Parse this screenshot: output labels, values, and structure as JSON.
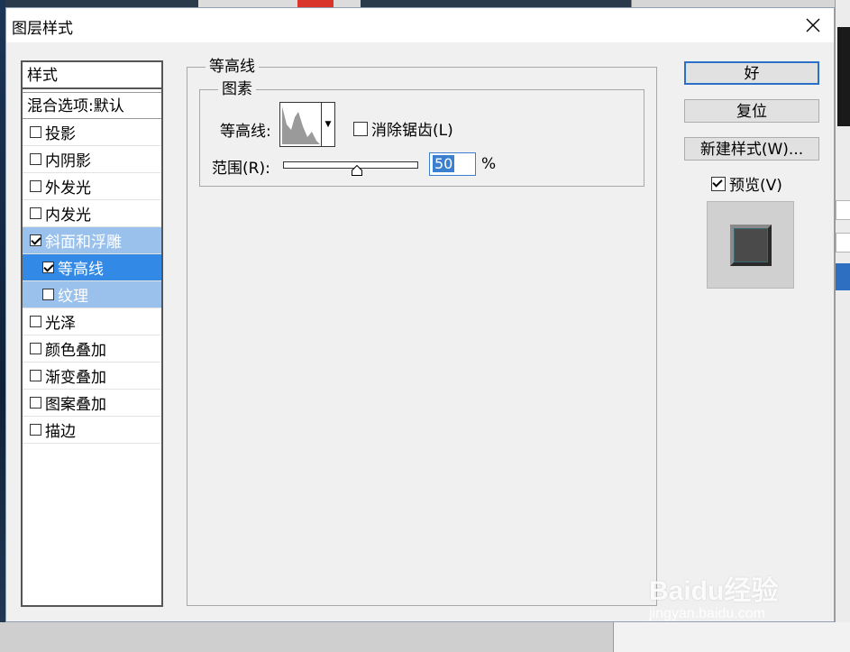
{
  "dialog": {
    "title": "图层样式"
  },
  "style_list": {
    "header": "样式",
    "blend_options": "混合选项:默认",
    "items": [
      {
        "label": "投影",
        "checked": false
      },
      {
        "label": "内阴影",
        "checked": false
      },
      {
        "label": "外发光",
        "checked": false
      },
      {
        "label": "内发光",
        "checked": false
      },
      {
        "label": "斜面和浮雕",
        "checked": true
      },
      {
        "label": "等高线",
        "checked": true
      },
      {
        "label": "纹理",
        "checked": false
      },
      {
        "label": "光泽",
        "checked": false
      },
      {
        "label": "颜色叠加",
        "checked": false
      },
      {
        "label": "渐变叠加",
        "checked": false
      },
      {
        "label": "图案叠加",
        "checked": false
      },
      {
        "label": "描边",
        "checked": false
      }
    ]
  },
  "contour_panel": {
    "group_title": "等高线",
    "subgroup_title": "图素",
    "contour_label": "等高线:",
    "antialias_label": "消除锯齿(L)",
    "antialias_checked": false,
    "range_label": "范围(R):",
    "range_value": "50",
    "range_unit": "%",
    "range_percent": 50
  },
  "buttons": {
    "ok": "好",
    "reset": "复位",
    "new_style": "新建样式(W)...",
    "preview_label": "预览(V)",
    "preview_checked": true
  },
  "watermark": {
    "logo": "Baidu经验",
    "url": "jingyan.baidu.com"
  },
  "colors": {
    "selection_strong": "#3289e6",
    "selection_light": "#99c1ec",
    "default_button_border": "#2c6fc8"
  }
}
